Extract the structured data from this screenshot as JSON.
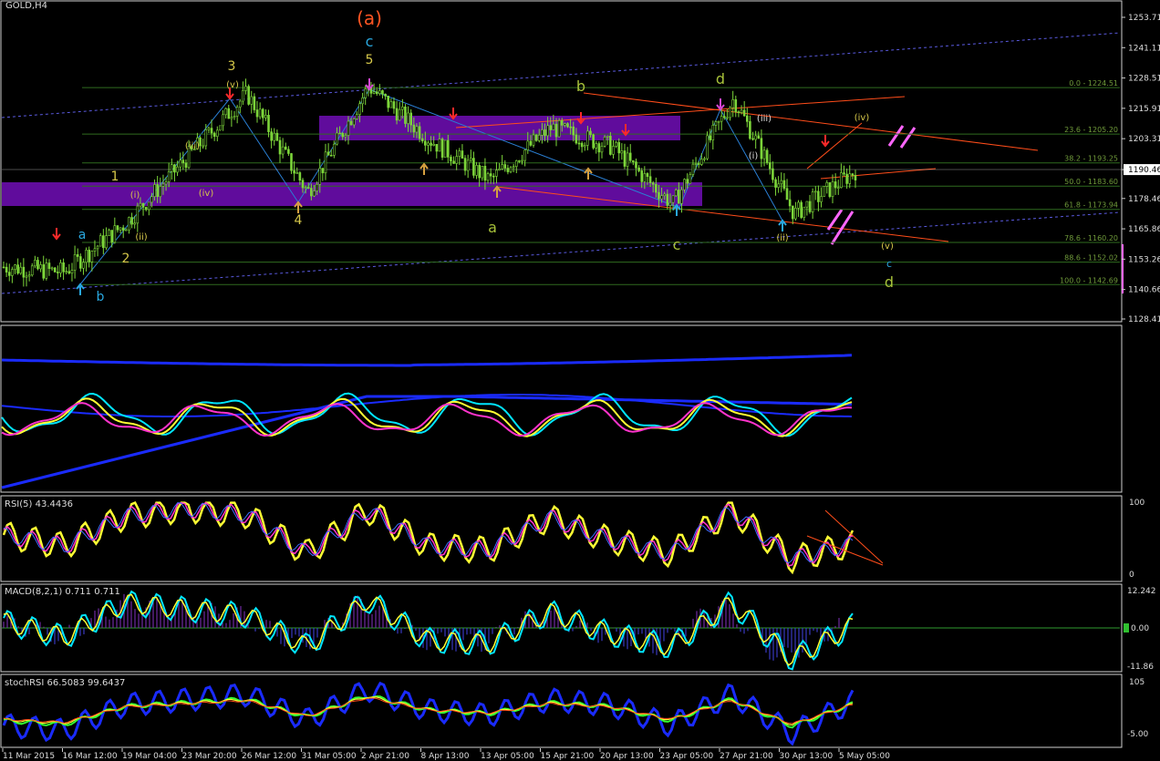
{
  "window": {
    "title": "GOLD,H4"
  },
  "colors": {
    "background": "#000000",
    "candle": "#7dd63a",
    "grid_separator": "#e0e0e0",
    "fib_line": "#2f6b1f",
    "fib_text": "#6f9a3a",
    "zone": "#6a0dad",
    "orange_line": "#ff4d1a",
    "blue_dashed": "#5a5adf",
    "label_yellow": "#d6c84a",
    "label_cyan": "#29a8e0",
    "label_olive": "#a8c23a",
    "label_magenta": "#d646d6",
    "label_red_orange": "#ff5522"
  },
  "price_axis": {
    "ticks": [
      "1253.71",
      "1241.11",
      "1228.51",
      "1215.91",
      "1203.31",
      "1190.46",
      "1178.46",
      "1165.86",
      "1153.26",
      "1140.66",
      "1128.41"
    ],
    "current_price": "1190.46"
  },
  "fib_levels": [
    {
      "label": "0.0 - 1224.51",
      "price": 1224.51
    },
    {
      "label": "23.6 - 1205.20",
      "price": 1205.2
    },
    {
      "label": "38.2 - 1193.25",
      "price": 1193.25
    },
    {
      "label": "50.0 - 1183.60",
      "price": 1183.6
    },
    {
      "label": "61.8 - 1173.94",
      "price": 1173.94
    },
    {
      "label": "78.6 - 1160.20",
      "price": 1160.2
    },
    {
      "label": "88.6 - 1152.02",
      "price": 1152.02
    },
    {
      "label": "100.0 - 1142.69",
      "price": 1142.69
    }
  ],
  "time_axis": {
    "labels": [
      "11 Mar 2015",
      "16 Mar 12:00",
      "19 Mar 04:00",
      "23 Mar 20:00",
      "26 Mar 12:00",
      "31 Mar 05:00",
      "2 Apr 21:00",
      "8 Apr 13:00",
      "13 Apr 05:00",
      "15 Apr 21:00",
      "20 Apr 13:00",
      "23 Apr 05:00",
      "27 Apr 21:00",
      "30 Apr 13:00",
      "5 May 05:00"
    ]
  },
  "wave_labels": [
    {
      "text": "(a)",
      "color": "#ff5522"
    },
    {
      "text": "c",
      "color": "#29a8e0"
    },
    {
      "text": "5",
      "color": "#d6c84a"
    },
    {
      "text": "3",
      "color": "#d6c84a"
    },
    {
      "text": "4",
      "color": "#d6c84a"
    },
    {
      "text": "1",
      "color": "#d6c84a"
    },
    {
      "text": "2",
      "color": "#d6c84a"
    },
    {
      "text": "a",
      "color": "#29a8e0"
    },
    {
      "text": "b",
      "color": "#29a8e0"
    },
    {
      "text": "b",
      "color": "#a8c23a"
    },
    {
      "text": "a",
      "color": "#a8c23a"
    },
    {
      "text": "c",
      "color": "#a8c23a"
    },
    {
      "text": "d",
      "color": "#a8c23a"
    },
    {
      "text": "d",
      "color": "#a8c23a"
    },
    {
      "text": "c",
      "color": "#29a8e0"
    },
    {
      "text": "(v)",
      "color": "#d6c84a"
    },
    {
      "text": "(iii)",
      "color": "#d6c84a"
    },
    {
      "text": "(iv)",
      "color": "#d6c84a"
    },
    {
      "text": "(i)",
      "color": "#d6c84a"
    },
    {
      "text": "(ii)",
      "color": "#d6c84a"
    },
    {
      "text": "(iv)",
      "color": "#d6c84a"
    },
    {
      "text": "(ii)",
      "color": "#d6c84a"
    },
    {
      "text": "(i)",
      "color": "#dddddd"
    },
    {
      "text": "(iii)",
      "color": "#dddddd"
    },
    {
      "text": "(v)",
      "color": "#d6c84a"
    }
  ],
  "indicators": {
    "rsi": {
      "label": "RSI(5) 43.4436",
      "top": "100",
      "bottom": "0"
    },
    "macd": {
      "label": "MACD(8,2,1) 0.711 0.711",
      "top": "12.242",
      "zero": "0.00",
      "bottom": "-11.86"
    },
    "stochrsi": {
      "label": "stochRSI 66.5083 99.6437",
      "top": "105",
      "bottom": "-5.00"
    }
  },
  "chart_data": [
    {
      "type": "line",
      "title": "GOLD,H4",
      "ylim": [
        1128.41,
        1253.71
      ],
      "x": [
        "11 Mar 2015",
        "16 Mar 12:00",
        "19 Mar 04:00",
        "23 Mar 20:00",
        "26 Mar 12:00",
        "31 Mar 05:00",
        "2 Apr 21:00",
        "8 Apr 13:00",
        "13 Apr 05:00",
        "15 Apr 21:00",
        "20 Apr 13:00",
        "23 Apr 05:00",
        "27 Apr 21:00",
        "30 Apr 13:00",
        "5 May 05:00"
      ],
      "series": [
        {
          "values": [
            1150,
            1148,
            1168,
            1195,
            1222,
            1181,
            1225,
            1203,
            1186,
            1208,
            1200,
            1176,
            1220,
            1172,
            1190
          ]
        }
      ]
    },
    {
      "type": "line",
      "title": "RSI(5) 43.4436",
      "ylim": [
        0,
        100
      ],
      "series": [
        {
          "values": [
            55,
            40,
            80,
            90,
            82,
            30,
            88,
            40,
            35,
            78,
            48,
            30,
            88,
            22,
            43
          ]
        }
      ]
    },
    {
      "type": "line",
      "title": "MACD(8,2,1) 0.711 0.711",
      "ylim": [
        -11.86,
        12.242
      ],
      "series": [
        {
          "values": [
            2,
            -3,
            8,
            6,
            4,
            -6,
            9,
            -4,
            -5,
            5,
            -2,
            -6,
            8,
            -10,
            0.711
          ]
        }
      ]
    },
    {
      "type": "line",
      "title": "stochRSI 66.5083 99.6437",
      "ylim": [
        -5,
        105
      ],
      "series": [
        {
          "values": [
            20,
            10,
            60,
            70,
            80,
            30,
            90,
            50,
            40,
            70,
            60,
            20,
            80,
            5,
            66.5
          ]
        }
      ]
    }
  ]
}
